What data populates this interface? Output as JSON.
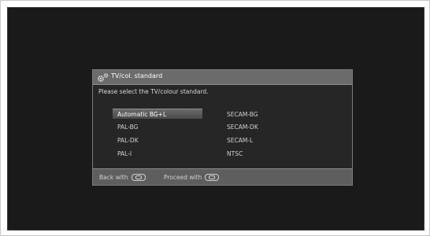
{
  "dialog": {
    "title": "TV/col. standard",
    "title_icon": "gear-icon",
    "prompt": "Please select the TV/colour standard.",
    "selected_option": "Automatic BG+L",
    "options_left": [
      "Automatic BG+L",
      "PAL-BG",
      "PAL-DK",
      "PAL-I"
    ],
    "options_right": [
      "SECAM-BG",
      "SECAM-DK",
      "SECAM-L",
      "NTSC"
    ]
  },
  "footer": {
    "back_label": "Back with",
    "back_icon": "back-button-icon",
    "proceed_label": "Proceed with",
    "proceed_icon": "forward-button-icon"
  },
  "colors": {
    "screen_bg": "#1a1a1a",
    "dialog_bg": "#5e5e5e",
    "body_bg": "#262626",
    "text": "#d0d0d0"
  }
}
